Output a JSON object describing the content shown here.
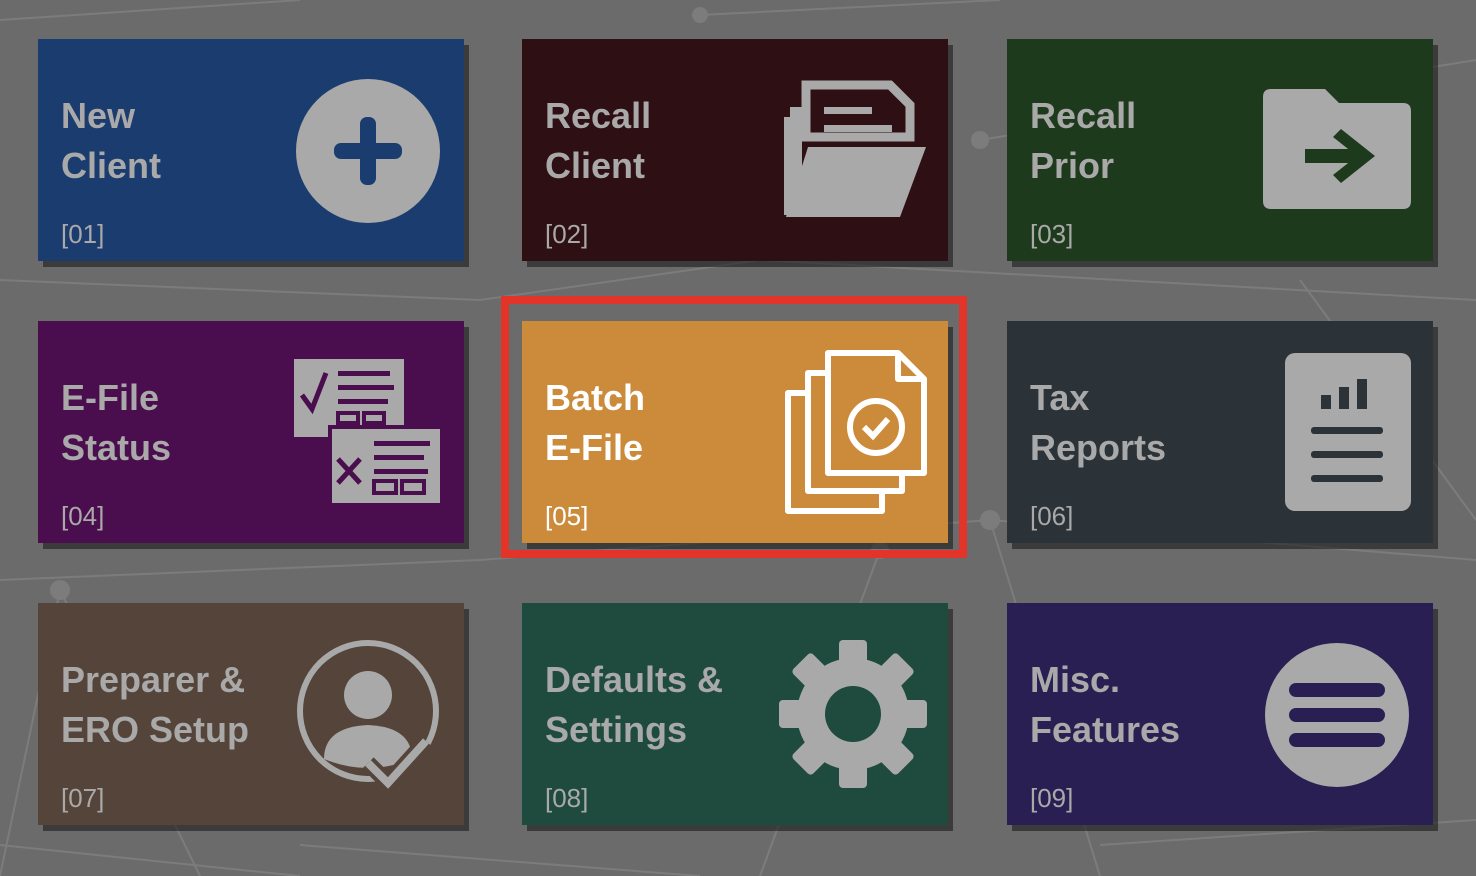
{
  "tiles": [
    {
      "name": "tile-new-client",
      "line1": "New",
      "line2": "Client",
      "code": "[01]",
      "color": "#1b3c6f",
      "icon": "plus-circle-icon"
    },
    {
      "name": "tile-recall-client",
      "line1": "Recall",
      "line2": "Client",
      "code": "[02]",
      "color": "#2d0f14",
      "icon": "open-folder-icon"
    },
    {
      "name": "tile-recall-prior",
      "line1": "Recall",
      "line2": "Prior",
      "code": "[03]",
      "color": "#1e3a1c",
      "icon": "folder-arrow-icon"
    },
    {
      "name": "tile-efile-status",
      "line1": "E-File",
      "line2": "Status",
      "code": "[04]",
      "color": "#4a0d4d",
      "icon": "checklist-forms-icon"
    },
    {
      "name": "tile-batch-efile",
      "line1": "Batch",
      "line2": "E-File",
      "code": "[05]",
      "color": "#cc8a3b",
      "icon": "stacked-documents-check-icon"
    },
    {
      "name": "tile-tax-reports",
      "line1": "Tax",
      "line2": "Reports",
      "code": "[06]",
      "color": "#2b3238",
      "icon": "report-chart-icon"
    },
    {
      "name": "tile-preparer-ero-setup",
      "line1": "Preparer &",
      "line2": "ERO Setup",
      "code": "[07]",
      "color": "#54443a",
      "icon": "user-check-icon"
    },
    {
      "name": "tile-defaults-settings",
      "line1": "Defaults &",
      "line2": "Settings",
      "code": "[08]",
      "color": "#1f4b3f",
      "icon": "gear-icon"
    },
    {
      "name": "tile-misc-features",
      "line1": "Misc.",
      "line2": "Features",
      "code": "[09]",
      "color": "#2a1f52",
      "icon": "menu-circle-icon"
    }
  ],
  "selected_index": 4,
  "highlight_color": "#e3342a"
}
